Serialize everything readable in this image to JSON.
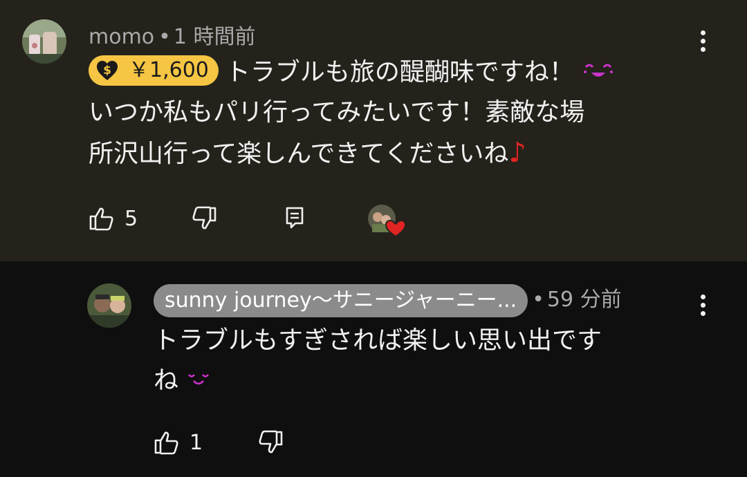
{
  "comment": {
    "author": "momo",
    "separator": "•",
    "time": "1 時間前",
    "super_thanks": "￥1,600",
    "line1": "トラブルも旅の醍醐味ですね！",
    "line2": "いつか私もパリ行ってみたいです！素敵な場",
    "line3": "所沢山行って楽しんできてくださいね",
    "note": "♪",
    "likes": "5",
    "icons": {
      "like": "thumbs-up-icon",
      "dislike": "thumbs-down-icon",
      "reply": "reply-comment-icon",
      "creator_heart": "creator-heart-icon",
      "more": "more-vert-icon"
    }
  },
  "reply": {
    "author": "sunny journey〜サニージャーニー...",
    "separator": "•",
    "time": "59 分前",
    "line1": "トラブルもすぎされば楽しい思い出です",
    "line2": "ね",
    "likes": "1"
  },
  "colors": {
    "highlight_bg": "#24221b",
    "page_bg": "#0f0f0f",
    "super_thanks": "#f5c543",
    "creator_chip": "#8b8b8b",
    "emoji_purple": "#cc33cc",
    "heart_red": "#e02424"
  }
}
